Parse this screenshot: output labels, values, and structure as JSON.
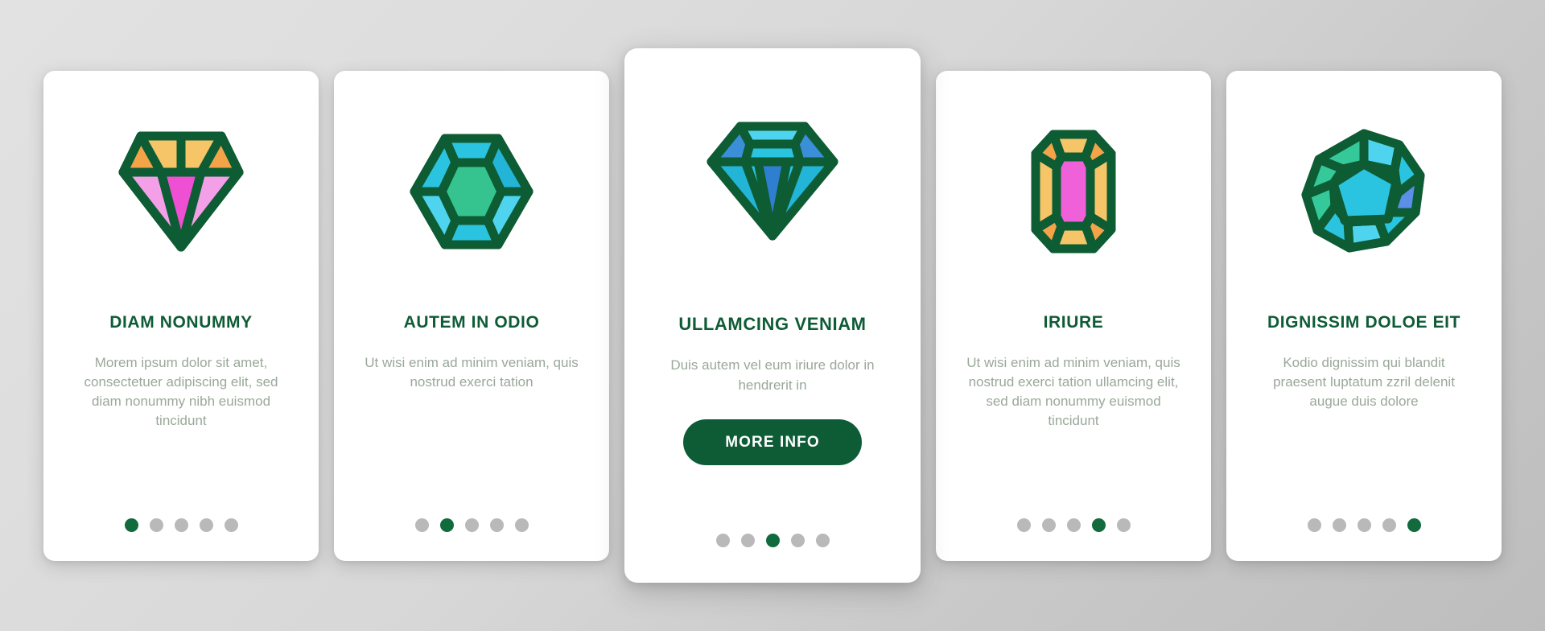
{
  "screen": {
    "background_top": "#e2e2e2",
    "background_bottom": "#bdbdbd",
    "accent_green": "#0e5c36",
    "dot_active_color": "#116b3c",
    "dot_inactive_color": "#b9b9b9",
    "body_text_color": "#9aa89a"
  },
  "cards": [
    {
      "id": "card-1",
      "icon": "pink-brilliant-diamond-icon",
      "title": "DIAM NONUMMY",
      "description": "Morem ipsum dolor sit amet, consectetuer adipiscing elit, sed diam nonummy nibh euismod tincidunt",
      "featured": false,
      "dots": {
        "count": 5,
        "active_index": 0
      }
    },
    {
      "id": "card-2",
      "icon": "hexagon-gem-icon",
      "title": "AUTEM IN ODIO",
      "description": "Ut wisi enim ad minim veniam, quis nostrud exerci tation",
      "featured": false,
      "dots": {
        "count": 5,
        "active_index": 1
      }
    },
    {
      "id": "card-3",
      "icon": "blue-brilliant-diamond-icon",
      "title": "ULLAMCING VENIAM",
      "description": "Duis autem vel eum iriure dolor in hendrerit in",
      "button_label": "MORE INFO",
      "featured": true,
      "dots": {
        "count": 5,
        "active_index": 2
      }
    },
    {
      "id": "card-4",
      "icon": "emerald-cut-gem-icon",
      "title": "IRIURE",
      "description": "Ut wisi enim ad minim veniam, quis nostrud exerci tation ullamcing elit, sed diam nonummy euismod tincidunt",
      "featured": false,
      "dots": {
        "count": 5,
        "active_index": 3
      }
    },
    {
      "id": "card-5",
      "icon": "round-gem-icon",
      "title": "DIGNISSIM DOLOE EIT",
      "description": "Kodio dignissim qui blandit praesent luptatum zzril delenit augue duis dolore",
      "featured": false,
      "dots": {
        "count": 5,
        "active_index": 4
      }
    }
  ],
  "icon_palette": {
    "outline": "#0d5c33",
    "pink_light": "#f4a0e8",
    "pink_mid": "#f060d8",
    "pink_deep": "#ef4fd2",
    "amber_light": "#f6c567",
    "amber_mid": "#f4a448",
    "cyan_light": "#4fd4ef",
    "cyan_mid": "#2bc4e0",
    "cyan_deep": "#23b5d8",
    "teal": "#35c99a",
    "blue_mid": "#3a8fd8",
    "blue_deep": "#2f7fd0",
    "blue_royal": "#5b8fe8",
    "green_center": "#35c48f"
  }
}
